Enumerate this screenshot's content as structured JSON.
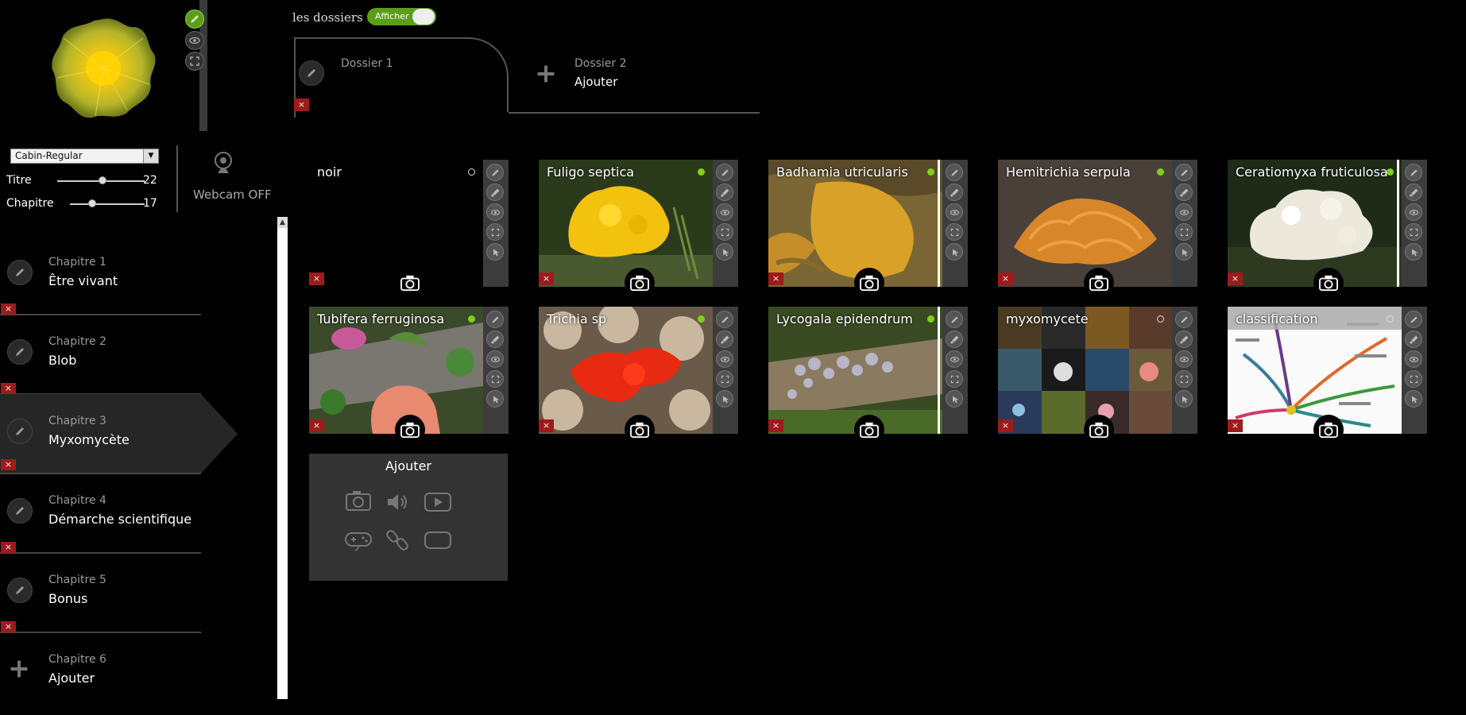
{
  "colors": {
    "accent_green": "#5a9e1a",
    "status_green": "#7fd11a",
    "delete_red": "#9e1b1b"
  },
  "folders": {
    "label": "les dossiers :",
    "toggle_label": "Afficher"
  },
  "tabs": [
    {
      "num": "Dossier 1",
      "name": ""
    },
    {
      "num": "Dossier 2",
      "name": "Ajouter"
    }
  ],
  "font": {
    "selected": "Cabin-Regular"
  },
  "sliders": [
    {
      "label": "Titre",
      "value": "22",
      "fraction": 0.52
    },
    {
      "label": "Chapitre",
      "value": "17",
      "fraction": 0.3
    }
  ],
  "webcam": {
    "label": "Webcam OFF"
  },
  "chapters": [
    {
      "num": "Chapitre 1",
      "name": "Être vivant"
    },
    {
      "num": "Chapitre 2",
      "name": "Blob"
    },
    {
      "num": "Chapitre 3",
      "name": "Myxomycète"
    },
    {
      "num": "Chapitre 4",
      "name": "Démarche scientifique"
    },
    {
      "num": "Chapitre 5",
      "name": "Bonus"
    },
    {
      "num": "Chapitre 6",
      "name": "Ajouter"
    }
  ],
  "cards": [
    {
      "title": "noir",
      "status": "empty"
    },
    {
      "title": "Fuligo septica",
      "status": "active"
    },
    {
      "title": "Badhamia utricularis",
      "status": "active"
    },
    {
      "title": "Hemitrichia serpula",
      "status": "active"
    },
    {
      "title": "Ceratiomyxa fruticulosa",
      "status": "active"
    },
    {
      "title": "Tubifera ferruginosa",
      "status": "active"
    },
    {
      "title": "Trichia sp",
      "status": "active"
    },
    {
      "title": "Lycogala epidendrum",
      "status": "active"
    },
    {
      "title": "myxomycete",
      "status": "empty"
    },
    {
      "title": "classification",
      "status": "empty"
    }
  ],
  "add_box": {
    "title": "Ajouter"
  },
  "icons": {
    "delete": "×",
    "tool_icons": [
      "pencil-icon",
      "brush-icon",
      "eye-icon",
      "fullscreen-icon",
      "cursor-icon"
    ],
    "add_icons": [
      "camera-icon",
      "speaker-icon",
      "play-icon",
      "gamepad-icon",
      "link-icon",
      "blank-frame-icon"
    ]
  }
}
